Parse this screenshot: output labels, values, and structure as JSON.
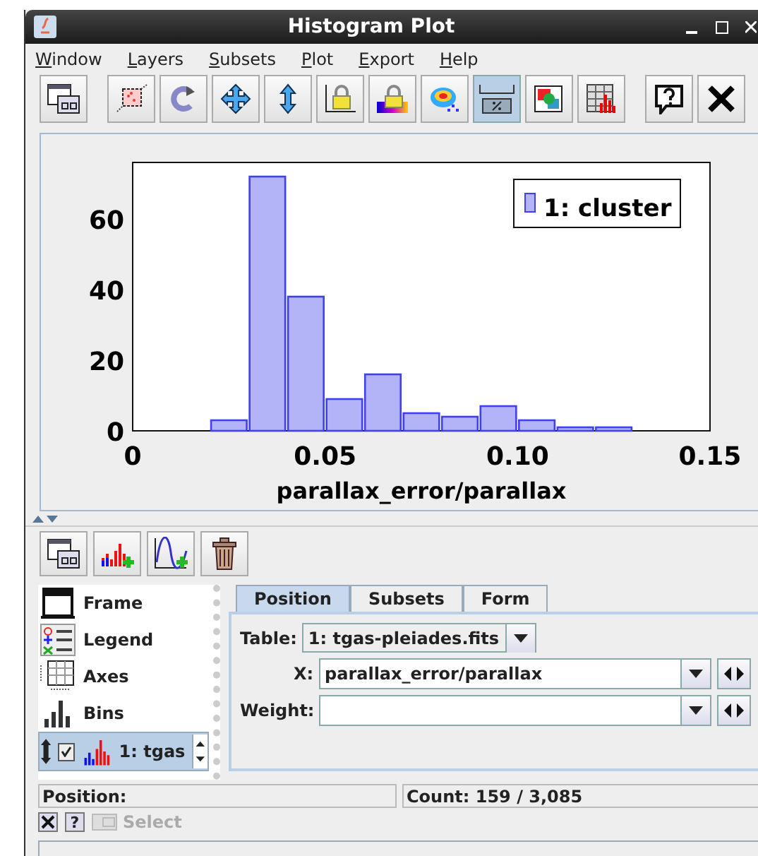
{
  "window": {
    "title": "Histogram Plot"
  },
  "menu": [
    "Window",
    "Layers",
    "Subsets",
    "Plot",
    "Export",
    "Help"
  ],
  "toolbar_groups": [
    {
      "buttons": [
        {
          "kind": "window",
          "selected": false
        }
      ]
    },
    {
      "buttons": [
        {
          "kind": "zoom-box",
          "selected": false
        },
        {
          "kind": "rotate",
          "selected": false
        },
        {
          "kind": "pan",
          "selected": false
        },
        {
          "kind": "stretch",
          "selected": false
        },
        {
          "kind": "axis-lock",
          "selected": false
        },
        {
          "kind": "color-lock",
          "selected": false
        },
        {
          "kind": "density",
          "selected": false
        },
        {
          "kind": "percent",
          "selected": true
        },
        {
          "kind": "layers",
          "selected": false
        },
        {
          "kind": "table-hist",
          "selected": false
        }
      ]
    },
    {
      "buttons": [
        {
          "kind": "help",
          "selected": false
        },
        {
          "kind": "close",
          "selected": false
        }
      ]
    }
  ],
  "plot": {
    "chart_data": {
      "type": "bar",
      "xlabel": "parallax_error/parallax",
      "x": [
        0.025,
        0.035,
        0.045,
        0.055,
        0.065,
        0.075,
        0.085,
        0.095,
        0.105,
        0.115,
        0.125
      ],
      "series": [
        {
          "name": "1: cluster",
          "color": "#b3b3f7",
          "values": [
            3,
            72,
            38,
            9,
            16,
            5,
            4,
            7,
            3,
            1,
            1
          ]
        }
      ],
      "xlim": [
        0,
        0.15
      ],
      "ylim": [
        0,
        76
      ],
      "xticks": [
        0,
        {
          "value": 0.05,
          "label": "0.05"
        },
        {
          "value": 0.1,
          "label": "0.10"
        },
        {
          "value": 0.15,
          "label": "0.15"
        }
      ],
      "yticks": [
        0,
        20,
        40,
        60
      ]
    }
  },
  "layer_toolbar": [
    {
      "kind": "window"
    },
    {
      "kind": "add-hist"
    },
    {
      "kind": "add-function"
    },
    {
      "kind": "delete"
    }
  ],
  "layers": [
    {
      "kind": "frame",
      "label": "Frame",
      "selected": false
    },
    {
      "kind": "legend",
      "label": "Legend",
      "selected": false
    },
    {
      "kind": "axes",
      "label": "Axes",
      "selected": false
    },
    {
      "kind": "bins",
      "label": "Bins",
      "selected": false
    },
    {
      "kind": "histogram",
      "label": "1: tgas",
      "selected": true,
      "checked": true
    }
  ],
  "tabs": [
    {
      "label": "Position",
      "selected": true
    },
    {
      "label": "Subsets",
      "selected": false
    },
    {
      "label": "Form",
      "selected": false
    }
  ],
  "form": {
    "table": {
      "label": "Table:",
      "value": "1: tgas-pleiades.fits"
    },
    "x": {
      "label": "X:",
      "value": "parallax_error/parallax"
    },
    "weight": {
      "label": "Weight:"
    }
  },
  "status": {
    "position": "Position:",
    "count": "Count: 159 / 3,085"
  },
  "bottom": {
    "select": {
      "label": "Select",
      "disabled": true
    },
    "help": "?"
  }
}
